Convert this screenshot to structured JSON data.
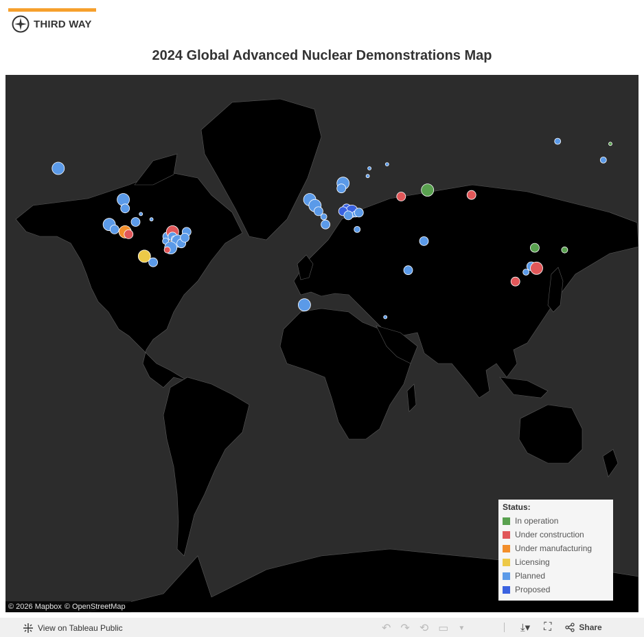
{
  "brand": {
    "name": "THIRD WAY"
  },
  "title": "2024 Global Advanced Nuclear Demonstrations Map",
  "attribution": [
    "© 2026 Mapbox",
    "© OpenStreetMap"
  ],
  "legend": {
    "title": "Status:",
    "items": [
      {
        "label": "In operation",
        "color": "#59a14f"
      },
      {
        "label": "Under construction",
        "color": "#e15759"
      },
      {
        "label": "Under manufacturing",
        "color": "#f28e2b"
      },
      {
        "label": "Licensing",
        "color": "#edc948"
      },
      {
        "label": "Planned",
        "color": "#5b9ae8"
      },
      {
        "label": "Proposed",
        "color": "#3a62e0"
      }
    ]
  },
  "footer": {
    "view_label": "View on Tableau Public",
    "share_label": "Share"
  },
  "map_data": {
    "sites": [
      {
        "lon": -150,
        "lat": 64,
        "status": "Planned",
        "size": "large"
      },
      {
        "lon": -113,
        "lat": 55,
        "status": "Planned",
        "size": "large"
      },
      {
        "lon": -112,
        "lat": 52,
        "status": "Planned",
        "size": "medium"
      },
      {
        "lon": -103,
        "lat": 50,
        "status": "Planned",
        "size": "tiny"
      },
      {
        "lon": -106,
        "lat": 47,
        "status": "Planned",
        "size": "medium"
      },
      {
        "lon": -97,
        "lat": 48,
        "status": "Planned",
        "size": "tiny"
      },
      {
        "lon": -121,
        "lat": 46,
        "status": "Planned",
        "size": "large"
      },
      {
        "lon": -118,
        "lat": 44,
        "status": "Planned",
        "size": "medium"
      },
      {
        "lon": -112,
        "lat": 43,
        "status": "Under manufacturing",
        "size": "large"
      },
      {
        "lon": -110,
        "lat": 42,
        "status": "Under construction",
        "size": "medium"
      },
      {
        "lon": -101,
        "lat": 32,
        "status": "Licensing",
        "size": "large"
      },
      {
        "lon": -96,
        "lat": 29,
        "status": "Planned",
        "size": "medium"
      },
      {
        "lon": -88,
        "lat": 41,
        "status": "Planned",
        "size": "medium"
      },
      {
        "lon": -89,
        "lat": 39,
        "status": "Planned",
        "size": "small"
      },
      {
        "lon": -85,
        "lat": 43,
        "status": "Under construction",
        "size": "large"
      },
      {
        "lon": -85,
        "lat": 41,
        "status": "Planned",
        "size": "medium"
      },
      {
        "lon": -84,
        "lat": 40,
        "status": "Planned",
        "size": "small"
      },
      {
        "lon": -82,
        "lat": 39,
        "status": "Planned",
        "size": "large"
      },
      {
        "lon": -80,
        "lat": 38,
        "status": "Planned",
        "size": "medium"
      },
      {
        "lon": -86,
        "lat": 36,
        "status": "Planned",
        "size": "large"
      },
      {
        "lon": -88,
        "lat": 35,
        "status": "Under construction",
        "size": "small"
      },
      {
        "lon": -77,
        "lat": 43,
        "status": "Planned",
        "size": "medium"
      },
      {
        "lon": -78,
        "lat": 40.5,
        "status": "Planned",
        "size": "medium"
      },
      {
        "lon": -7,
        "lat": 55,
        "status": "Planned",
        "size": "large"
      },
      {
        "lon": -4,
        "lat": 53,
        "status": "Planned",
        "size": "large"
      },
      {
        "lon": -2,
        "lat": 51,
        "status": "Planned",
        "size": "medium"
      },
      {
        "lon": 1,
        "lat": 49,
        "status": "Planned",
        "size": "small"
      },
      {
        "lon": 2,
        "lat": 46,
        "status": "Planned",
        "size": "medium"
      },
      {
        "lon": 12,
        "lat": 60,
        "status": "Planned",
        "size": "large"
      },
      {
        "lon": 11,
        "lat": 58.5,
        "status": "Planned",
        "size": "medium"
      },
      {
        "lon": 14,
        "lat": 52,
        "status": "Proposed",
        "size": "medium"
      },
      {
        "lon": 17,
        "lat": 51,
        "status": "Proposed",
        "size": "large"
      },
      {
        "lon": 12,
        "lat": 51,
        "status": "Proposed",
        "size": "medium"
      },
      {
        "lon": 15,
        "lat": 49.5,
        "status": "Planned",
        "size": "medium"
      },
      {
        "lon": 19,
        "lat": 50,
        "status": "Planned",
        "size": "small"
      },
      {
        "lon": 21,
        "lat": 50.5,
        "status": "Planned",
        "size": "medium"
      },
      {
        "lon": 20,
        "lat": 44,
        "status": "Planned",
        "size": "small"
      },
      {
        "lon": 27,
        "lat": 64,
        "status": "Planned",
        "size": "tiny"
      },
      {
        "lon": 26,
        "lat": 62,
        "status": "Planned",
        "size": "tiny"
      },
      {
        "lon": 37,
        "lat": 65,
        "status": "Planned",
        "size": "tiny"
      },
      {
        "lon": 45,
        "lat": 56,
        "status": "Under construction",
        "size": "medium"
      },
      {
        "lon": 60,
        "lat": 58,
        "status": "In operation",
        "size": "large"
      },
      {
        "lon": 85,
        "lat": 56.5,
        "status": "Under construction",
        "size": "medium"
      },
      {
        "lon": 58,
        "lat": 39,
        "status": "Planned",
        "size": "medium"
      },
      {
        "lon": 49,
        "lat": 25,
        "status": "Planned",
        "size": "medium"
      },
      {
        "lon": -10,
        "lat": 6,
        "status": "Planned",
        "size": "large"
      },
      {
        "lon": 36,
        "lat": -1,
        "status": "Planned",
        "size": "tiny"
      },
      {
        "lon": 121,
        "lat": 36,
        "status": "In operation",
        "size": "medium"
      },
      {
        "lon": 138,
        "lat": 35,
        "status": "In operation",
        "size": "small"
      },
      {
        "lon": 119,
        "lat": 27,
        "status": "Planned",
        "size": "medium"
      },
      {
        "lon": 122,
        "lat": 26,
        "status": "Under construction",
        "size": "large"
      },
      {
        "lon": 116,
        "lat": 24,
        "status": "Planned",
        "size": "small"
      },
      {
        "lon": 110,
        "lat": 19,
        "status": "Under construction",
        "size": "medium"
      },
      {
        "lon": 134,
        "lat": 70,
        "status": "Planned",
        "size": "small"
      },
      {
        "lon": 164,
        "lat": 69.5,
        "status": "In operation",
        "size": "tiny"
      },
      {
        "lon": 160,
        "lat": 66,
        "status": "Planned",
        "size": "small"
      }
    ]
  }
}
